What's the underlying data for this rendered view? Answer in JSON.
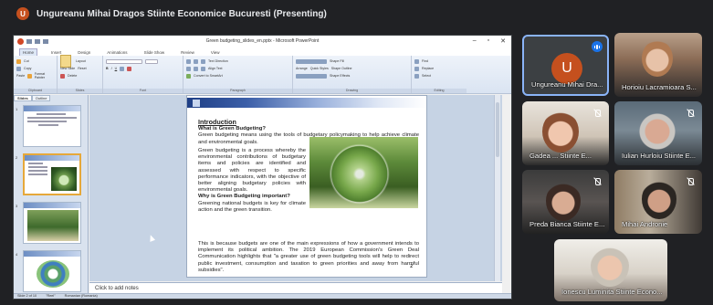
{
  "meeting": {
    "presenter_initial": "U",
    "presenting_title": "Ungureanu Mihai Dragos Stiinte Economice Bucuresti (Presenting)"
  },
  "ppt": {
    "window_title": "Green budgeting_slides_en.pptx - Microsoft PowerPoint",
    "ribbon_tabs": [
      "Home",
      "Insert",
      "Design",
      "Animations",
      "Slide Show",
      "Review",
      "View"
    ],
    "groups": {
      "clipboard": "Clipboard",
      "slides": "Slides",
      "font": "Font",
      "paragraph": "Paragraph",
      "drawing": "Drawing",
      "editing": "Editing"
    },
    "clipboard_items": [
      "Cut",
      "Copy",
      "Paste",
      "Format Painter"
    ],
    "slides_items": [
      "Layout",
      "Reset",
      "New Slide",
      "Delete"
    ],
    "paragraph_items": [
      "Text Direction",
      "Align Text",
      "Convert to SmartArt"
    ],
    "drawing_items": [
      "Arrange",
      "Quick Styles",
      "Shape Fill",
      "Shape Outline",
      "Shape Effects"
    ],
    "editing_items": [
      "Find",
      "Replace",
      "Select"
    ],
    "left_tabs": [
      "Slides",
      "Outline"
    ],
    "thumb_numbers": [
      "1",
      "2",
      "3",
      "4"
    ],
    "notes_placeholder": "Click to add notes",
    "status": [
      "Slide 2 of 10",
      "\"Reel\"",
      "Romanian (Romania)"
    ]
  },
  "slide": {
    "title": "Introduction",
    "q1": "What is Green Budgeting?",
    "p1_full": "Green budgeting means using the tools of budgetary policymaking to help achieve climate and environmental goals.",
    "p1_wrap": "Green budgeting is a process whereby the environmental contributions of budgetary items and policies are identified and assessed with respect to specific performance indicators, with the objective of better aligning budgetary policies with environmental goals.",
    "q2": "Why is Green Budgeting important?",
    "p2_wrap": "Greening national budgets is key for climate action and the green transition.",
    "p2_full": "This is because budgets are one of the main expressions of how a government intends to implement its political ambition. The 2019 European Commission's Green Deal Communication highlights that \"a greater use of green budgeting tools will help to redirect public investment, consumption and taxation to green priorities and away from harmful subsidies\".",
    "number": "2"
  },
  "participants": [
    {
      "name": "Ungureanu Mihai Dra...",
      "initial": "U"
    },
    {
      "name": "Horioiu Lacramioara S..."
    },
    {
      "name": "Gadea ... Stiinte E..."
    },
    {
      "name": "Iulian Hurloiu Stiinte E..."
    },
    {
      "name": "Preda Bianca Stiinte E..."
    },
    {
      "name": "Mihai Andronie"
    },
    {
      "name": "Ionescu Luminita Stiinte Econo..."
    }
  ],
  "colors": {
    "meet_bg": "#202124",
    "avatar_orange": "#c5501e",
    "speaking_blue": "#1a73e8"
  }
}
